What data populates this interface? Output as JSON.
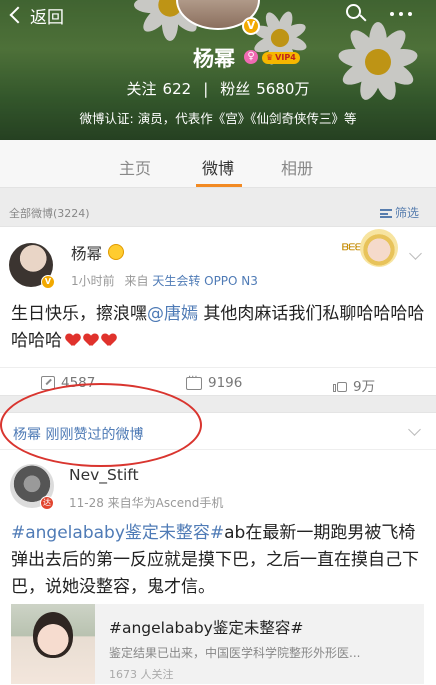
{
  "nav": {
    "back_label": "返回"
  },
  "profile": {
    "name": "杨幂",
    "vip_label": "VIP4",
    "follow_label": "关注",
    "follow_count": "622",
    "fans_label": "粉丝",
    "fans_count": "5680万",
    "verification": "微博认证: 演员，代表作《宫》《仙剑奇侠传三》等"
  },
  "tabs": [
    {
      "label": "主页",
      "active": false
    },
    {
      "label": "微博",
      "active": true
    },
    {
      "label": "相册",
      "active": false
    }
  ],
  "filter": {
    "count_label": "全部微博(3224)",
    "filter_label": "筛选"
  },
  "post1": {
    "author": "杨幂",
    "time": "1小时前",
    "source_prefix": "来自",
    "source": "天生会转 OPPO N3",
    "sticker_text": "ᗷᗴᗴ",
    "text_before": "生日快乐，擦浪嘿",
    "mention": "@唐嫣",
    "text_after": " 其他肉麻话我们私聊哈哈哈哈哈哈哈",
    "reposts": "4587",
    "comments": "9196",
    "likes": "9万"
  },
  "section": {
    "title": "杨幂 刚刚赞过的微博"
  },
  "post2": {
    "author": "Nev_Stift",
    "meta": "11-28  来自华为Ascend手机",
    "tag": "#angelababy鉴定未整容#",
    "text": "ab在最新一期跑男被飞椅弹出去后的第一反应就是摸下巴，之后一直在摸自己下巴，说她没整容，鬼才信。",
    "link_title": "#angelababy鉴定未整容#",
    "link_desc": "鉴定结果已出来，中国医学科学院整形外形医...",
    "link_more": "1673 人关注"
  },
  "colors": {
    "accent_orange": "#f28a23",
    "link_blue": "#4f7bb6",
    "highlight_red": "#d9352f"
  }
}
